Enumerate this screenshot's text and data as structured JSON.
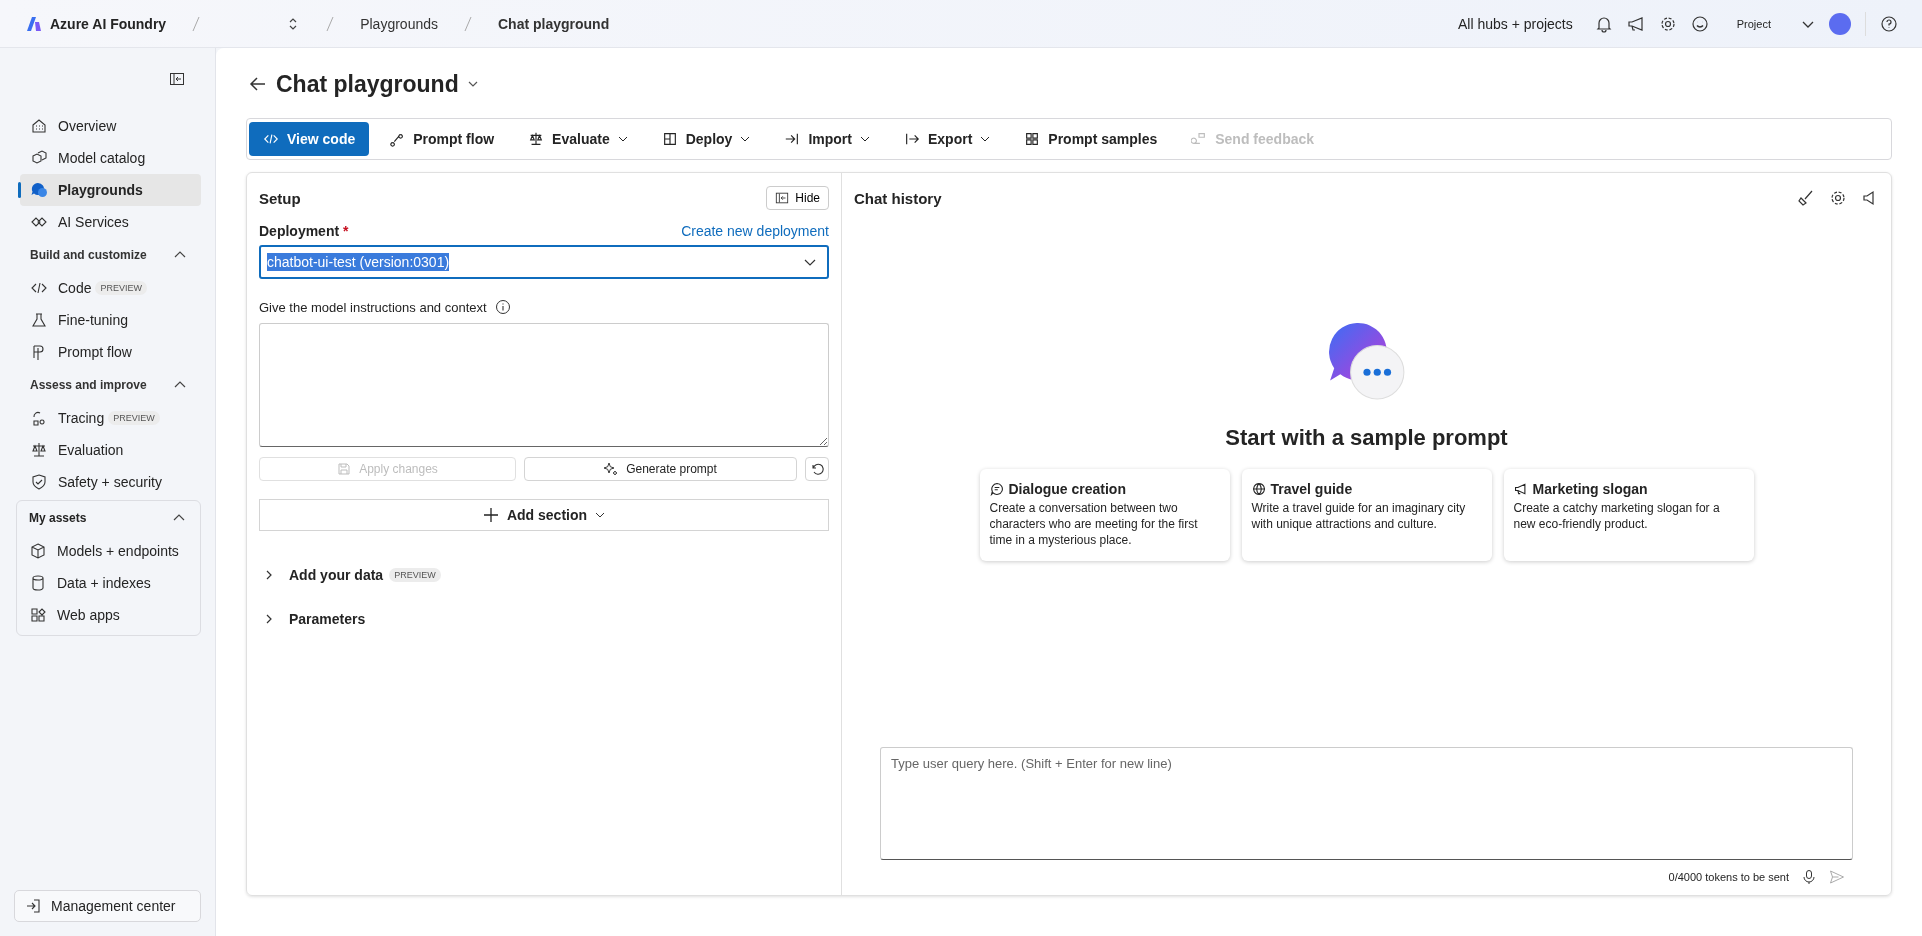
{
  "topbar": {
    "brand": "Azure AI Foundry",
    "breadcrumbs": [
      {
        "label": "Playgrounds",
        "current": false
      },
      {
        "label": "Chat playground",
        "current": true
      }
    ],
    "hub": "All hubs + projects",
    "project": "Project"
  },
  "sidebar": {
    "items": [
      {
        "label": "Overview",
        "selected": false
      },
      {
        "label": "Model catalog",
        "selected": false
      },
      {
        "label": "Playgrounds",
        "selected": true
      },
      {
        "label": "AI Services",
        "selected": false
      }
    ],
    "sections": [
      {
        "title": "Build and customize",
        "expanded": true,
        "items": [
          {
            "label": "Code",
            "badge": "PREVIEW"
          },
          {
            "label": "Fine-tuning"
          },
          {
            "label": "Prompt flow"
          }
        ]
      },
      {
        "title": "Assess and improve",
        "expanded": true,
        "items": [
          {
            "label": "Tracing",
            "badge": "PREVIEW"
          },
          {
            "label": "Evaluation"
          },
          {
            "label": "Safety + security"
          }
        ]
      }
    ],
    "assets": {
      "title": "My assets",
      "expanded": true,
      "items": [
        {
          "label": "Models + endpoints"
        },
        {
          "label": "Data + indexes"
        },
        {
          "label": "Web apps"
        }
      ]
    },
    "footer": "Management center"
  },
  "page": {
    "title": "Chat playground"
  },
  "toolbar": [
    {
      "label": "View code",
      "kind": "primary",
      "dropdown": false,
      "disabled": false
    },
    {
      "label": "Prompt flow",
      "kind": "default",
      "dropdown": false,
      "disabled": false
    },
    {
      "label": "Evaluate",
      "kind": "default",
      "dropdown": true,
      "disabled": false
    },
    {
      "label": "Deploy",
      "kind": "default",
      "dropdown": true,
      "disabled": false
    },
    {
      "label": "Import",
      "kind": "default",
      "dropdown": true,
      "disabled": false
    },
    {
      "label": "Export",
      "kind": "default",
      "dropdown": true,
      "disabled": false
    },
    {
      "label": "Prompt samples",
      "kind": "default",
      "dropdown": false,
      "disabled": false
    },
    {
      "label": "Send feedback",
      "kind": "default",
      "dropdown": false,
      "disabled": true
    }
  ],
  "setup": {
    "title": "Setup",
    "hide": "Hide",
    "deployment_label": "Deployment",
    "required_mark": "*",
    "create_link": "Create new deployment",
    "deployment_value": "chatbot-ui-test (version:0301)",
    "instructions_label": "Give the model instructions and context",
    "apply": {
      "label": "Apply changes",
      "disabled": true
    },
    "generate": {
      "label": "Generate prompt",
      "disabled": false
    },
    "add_section": "Add section",
    "collapsibles": [
      {
        "label": "Add your data",
        "badge": "PREVIEW",
        "expanded": false
      },
      {
        "label": "Parameters",
        "expanded": false
      }
    ]
  },
  "chat": {
    "title": "Chat history",
    "heading": "Start with a sample prompt",
    "samples": [
      {
        "title": "Dialogue creation",
        "text": "Create a conversation between two characters who are meeting for the first time in a mysterious place."
      },
      {
        "title": "Travel guide",
        "text": "Write a travel guide for an imaginary city with unique attractions and culture."
      },
      {
        "title": "Marketing slogan",
        "text": "Create a catchy marketing slogan for a new eco-friendly product."
      }
    ],
    "input_placeholder": "Type user query here. (Shift + Enter for new line)",
    "tokens": "0/4000 tokens to be sent"
  }
}
